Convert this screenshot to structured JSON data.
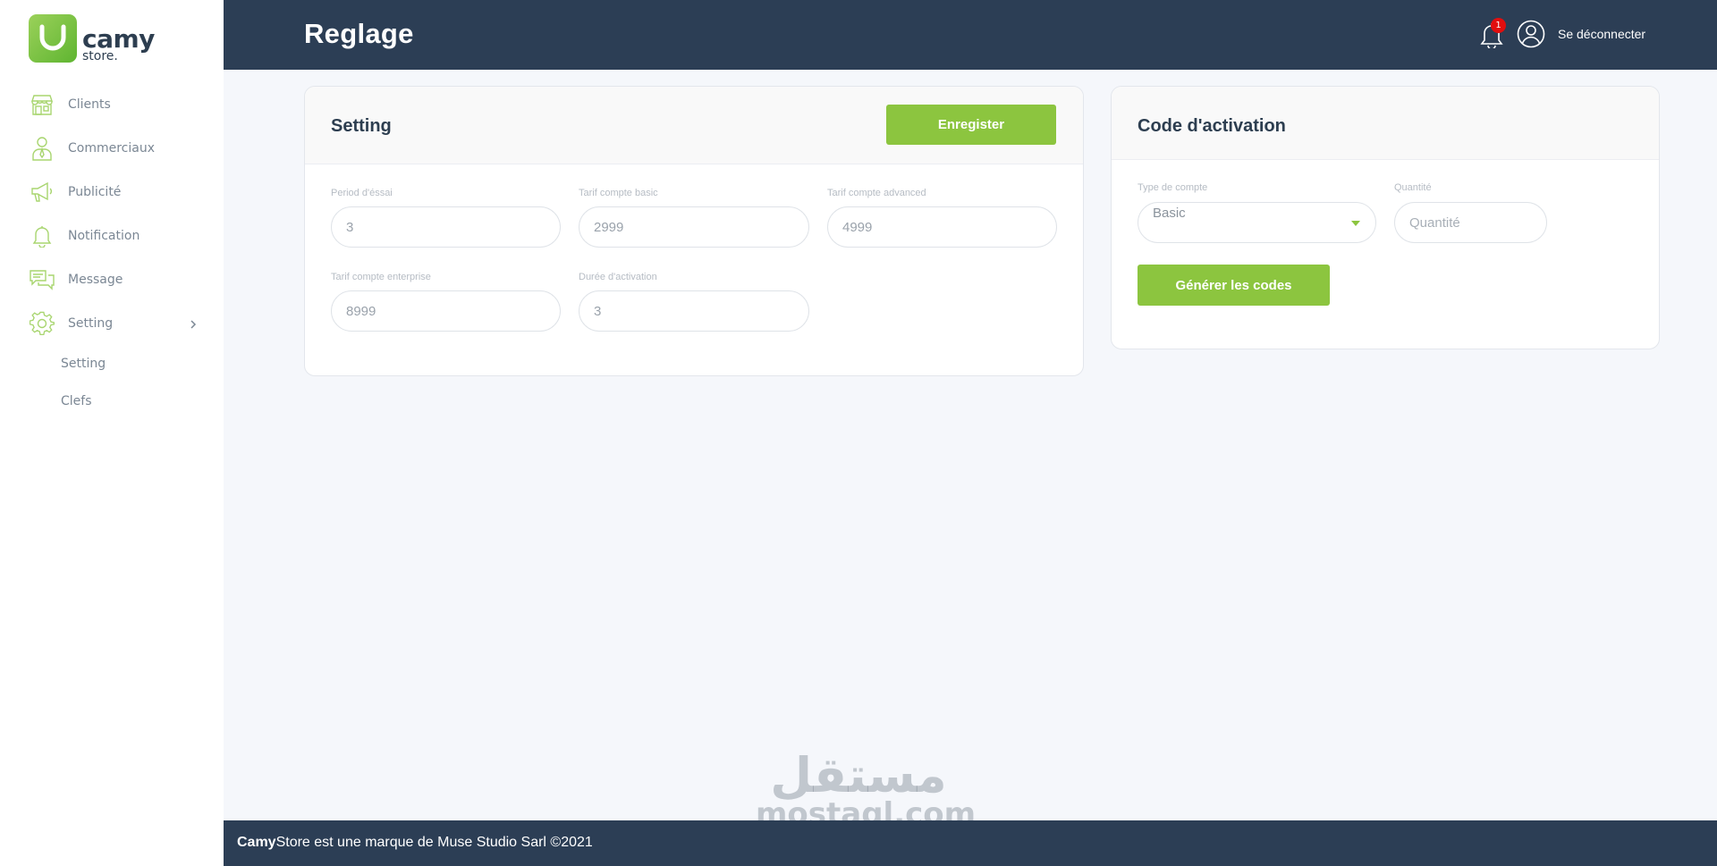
{
  "brand": {
    "name": "camy",
    "suffix": "store."
  },
  "sidebar": {
    "items": [
      {
        "label": "Clients",
        "icon": "store-icon"
      },
      {
        "label": "Commerciaux",
        "icon": "salesperson-icon"
      },
      {
        "label": "Publicité",
        "icon": "megaphone-icon"
      },
      {
        "label": "Notification",
        "icon": "bell-icon"
      },
      {
        "label": "Message",
        "icon": "chat-icon"
      },
      {
        "label": "Setting",
        "icon": "gear-icon"
      }
    ],
    "subitems": [
      {
        "label": "Setting"
      },
      {
        "label": "Clefs"
      }
    ]
  },
  "header": {
    "title": "Reglage",
    "notification_count": "1",
    "logout_label": "Se déconnecter"
  },
  "setting_card": {
    "title": "Setting",
    "save_label": "Enregister",
    "fields": [
      {
        "label": "Period d'éssai",
        "value": "3"
      },
      {
        "label": "Tarif compte basic",
        "value": "2999"
      },
      {
        "label": "Tarif compte advanced",
        "value": "4999"
      },
      {
        "label": "Tarif compte enterprise",
        "value": "8999"
      },
      {
        "label": "Durée d'activation",
        "value": "3"
      }
    ]
  },
  "activation_card": {
    "title": "Code d'activation",
    "type_label": "Type de compte",
    "type_value": "Basic",
    "quantity_label": "Quantité",
    "quantity_placeholder": "Quantité",
    "generate_label": "Générer les codes"
  },
  "footer": {
    "brand_bold": "Camy",
    "text": "Store est une marque de Muse Studio Sarl ©2021"
  },
  "watermark": {
    "arabic": "مستقل",
    "latin": "mostaql.com"
  },
  "colors": {
    "accent": "#8cc53f",
    "header_bg": "#2c3e55",
    "page_bg": "#f5f7fb",
    "badge": "#e10e0e"
  }
}
